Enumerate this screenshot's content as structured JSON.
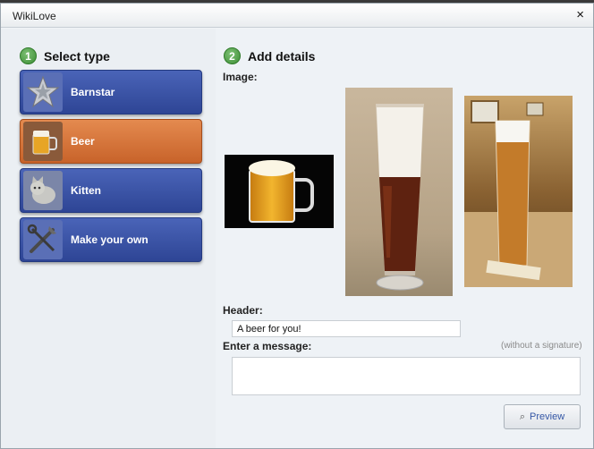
{
  "window": {
    "title": "WikiLove",
    "close_glyph": "×"
  },
  "step1": {
    "number": "1",
    "label": "Select type"
  },
  "step2": {
    "number": "2",
    "label": "Add details"
  },
  "types": [
    {
      "label": "Barnstar",
      "icon": "barnstar-icon",
      "selected": false
    },
    {
      "label": "Beer",
      "icon": "beer-icon",
      "selected": true
    },
    {
      "label": "Kitten",
      "icon": "kitten-icon",
      "selected": false
    },
    {
      "label": "Make your own",
      "icon": "tools-icon",
      "selected": false
    }
  ],
  "details": {
    "image_label": "Image:",
    "header_label": "Header:",
    "header_value": "A beer for you!",
    "message_label": "Enter a message:",
    "message_hint": "(without a signature)",
    "message_value": ""
  },
  "preview": {
    "label": "Preview",
    "icon": "magnifier-icon"
  },
  "colors": {
    "type_button": "#2e4595",
    "selected_button": "#c8632a",
    "step_badge": "#3d8f35"
  }
}
